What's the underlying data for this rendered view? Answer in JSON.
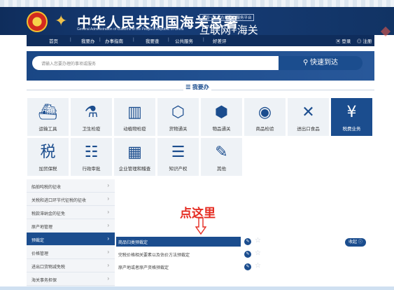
{
  "header": {
    "title": "中华人民共和国海关总署",
    "subtitle": "General Administration of Customs of the People's Republic of China",
    "badge": "全国一体化在线政务服务平台",
    "portal": "互联网+海关"
  },
  "nav": {
    "items": [
      "首页",
      "我要办",
      "办事指南",
      "我要查",
      "公共服务",
      "好差评"
    ],
    "login": "登录",
    "register": "注册"
  },
  "search": {
    "placeholder": "请输入您要办理的事项或服务",
    "button": "快速到达"
  },
  "banner_logo": "我要办",
  "tiles": [
    {
      "label": "运输工具",
      "icon": "ship-icon"
    },
    {
      "label": "卫生检疫",
      "icon": "microscope-icon"
    },
    {
      "label": "动植物检疫",
      "icon": "test-tubes-icon"
    },
    {
      "label": "货物通关",
      "icon": "box-icon"
    },
    {
      "label": "物品通关",
      "icon": "package-icon"
    },
    {
      "label": "商品检验",
      "icon": "eye-icon"
    },
    {
      "label": "进出口食品",
      "icon": "utensils-icon"
    },
    {
      "label": "税费业务",
      "icon": "tax-icon",
      "active": true
    },
    {
      "label": "加贸保税",
      "icon": "tax-circle-icon"
    },
    {
      "label": "行政审批",
      "icon": "approval-icon"
    },
    {
      "label": "企业管理和稽查",
      "icon": "building-icon"
    },
    {
      "label": "知识产权",
      "icon": "layers-icon"
    },
    {
      "label": "其他",
      "icon": "pin-icon"
    }
  ],
  "sidebar": [
    {
      "label": "船舶吨税的征收"
    },
    {
      "label": "关税和进口环节代征税的征收"
    },
    {
      "label": "税款滞纳金的征免"
    },
    {
      "label": "原产地管理"
    },
    {
      "label": "预裁定",
      "active": true
    },
    {
      "label": "价格管理"
    },
    {
      "label": "进出口货物减免税"
    },
    {
      "label": "海关事务担保"
    }
  ],
  "annotation": "点这里",
  "services": [
    {
      "label": "商品归类预裁定",
      "selected": true
    },
    {
      "label": "完税价格相关要素以及估价方法预裁定"
    },
    {
      "label": "原产地或者原产资格预裁定"
    }
  ],
  "collapse_label": "收起"
}
